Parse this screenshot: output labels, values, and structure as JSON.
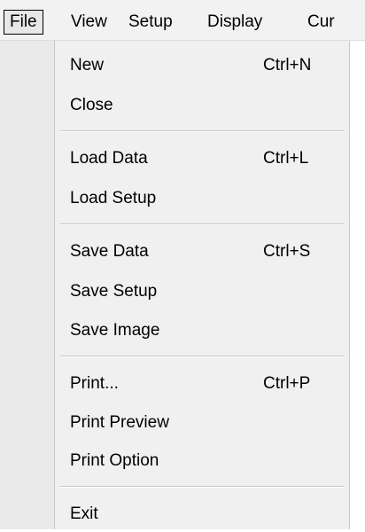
{
  "menubar": {
    "items": [
      {
        "label": "File",
        "active": true
      },
      {
        "label": "View"
      },
      {
        "label": "Setup"
      },
      {
        "label": "Display"
      },
      {
        "label": "Cur"
      }
    ]
  },
  "file_menu": {
    "items": [
      {
        "label": "New",
        "shortcut": "Ctrl+N"
      },
      {
        "label": "Close"
      },
      {
        "label": "Load Data",
        "shortcut": "Ctrl+L"
      },
      {
        "label": "Load Setup"
      },
      {
        "label": "Save Data",
        "shortcut": "Ctrl+S"
      },
      {
        "label": "Save Setup"
      },
      {
        "label": "Save Image"
      },
      {
        "label": "Print...",
        "shortcut": "Ctrl+P"
      },
      {
        "label": "Print Preview"
      },
      {
        "label": "Print Option"
      },
      {
        "label": "Exit"
      }
    ]
  },
  "colors": {
    "menu_background": "#f0f0f0",
    "gutter": "#e9e9e9",
    "separator": "#c6c6c6",
    "watermark": "#dbe8f3"
  }
}
